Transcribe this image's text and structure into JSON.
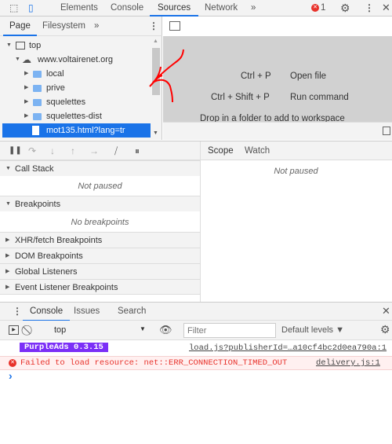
{
  "top_tabs": {
    "items": [
      "Elements",
      "Console",
      "Sources",
      "Network"
    ],
    "active": "Sources",
    "more": "»",
    "error_count": "1"
  },
  "navigator": {
    "tabs": [
      "Page",
      "Filesystem"
    ],
    "more": "»",
    "tree": [
      {
        "label": "top",
        "type": "frame"
      },
      {
        "label": "www.voltairenet.org",
        "type": "domain"
      },
      {
        "label": "local",
        "type": "folder"
      },
      {
        "label": "prive",
        "type": "folder"
      },
      {
        "label": "squelettes",
        "type": "folder"
      },
      {
        "label": "squelettes-dist",
        "type": "folder"
      },
      {
        "label": "mot135.html?lang=tr",
        "type": "file",
        "selected": true
      }
    ]
  },
  "editor": {
    "shortcuts": [
      {
        "keys": "Ctrl + P",
        "action": "Open file"
      },
      {
        "keys": "Ctrl + Shift + P",
        "action": "Run command"
      }
    ],
    "drop_hint": "Drop in a folder to add to workspace"
  },
  "debugger": {
    "sections": [
      {
        "title": "Call Stack",
        "content": "Not paused"
      },
      {
        "title": "Breakpoints",
        "content": "No breakpoints"
      },
      {
        "title": "XHR/fetch Breakpoints"
      },
      {
        "title": "DOM Breakpoints"
      },
      {
        "title": "Global Listeners"
      },
      {
        "title": "Event Listener Breakpoints"
      }
    ],
    "side_tabs": [
      "Scope",
      "Watch"
    ],
    "scope_content": "Not paused"
  },
  "drawer": {
    "tabs": [
      "Console",
      "Issues",
      "Search"
    ],
    "context": "top",
    "filter_placeholder": "Filter",
    "levels": "Default levels ▼",
    "messages": [
      {
        "type": "log",
        "badge": "PurpleAds 0.3.15",
        "source": "load.js?publisherId=…a10cf4bc2d0ea790a:1"
      },
      {
        "type": "error",
        "text": "Failed to load resource: net::ERR_CONNECTION_TIMED_OUT",
        "source": "delivery.js:1"
      }
    ],
    "prompt": "›"
  },
  "colors": {
    "accent": "#1a73e8",
    "error": "#e8322b",
    "badge": "#7b2ff7",
    "annotation": "#ff0000"
  }
}
